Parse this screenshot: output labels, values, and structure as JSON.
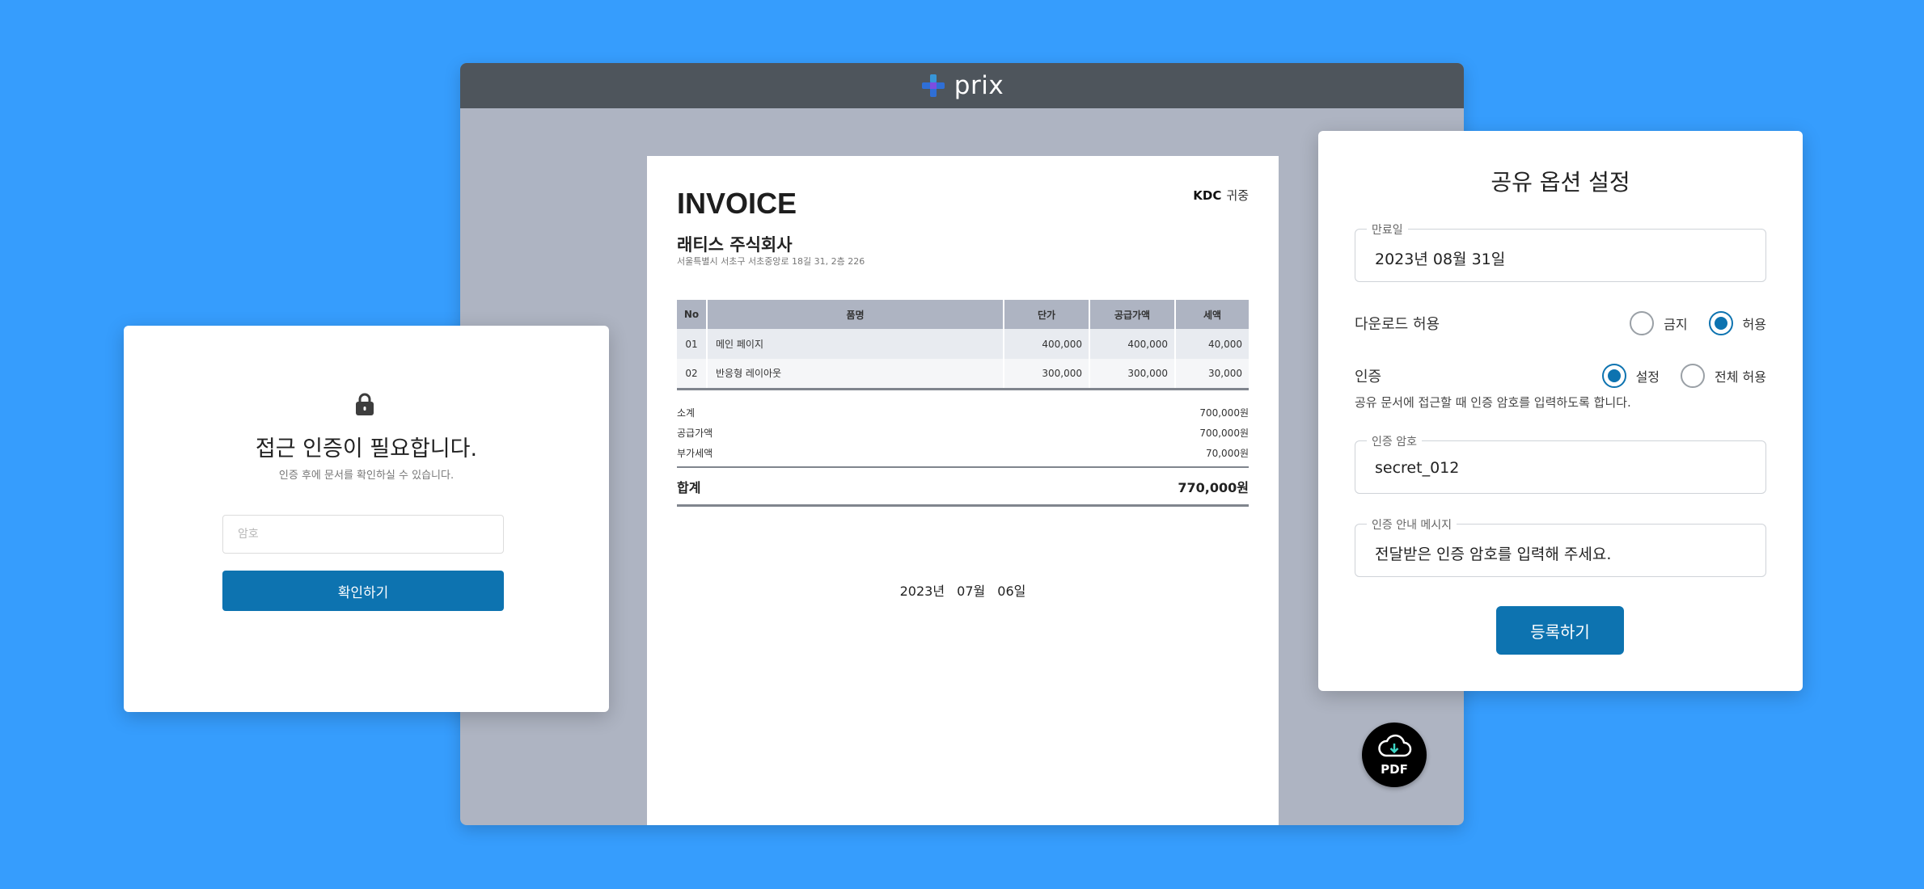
{
  "viewer": {
    "brand_name": "prix",
    "invoice": {
      "title": "INVOICE",
      "recipient_code": "KDC",
      "recipient_suffix": "귀중",
      "company_name": "래티스 주식회사",
      "company_address": "서울특별시 서초구 서초중앙로 18길 31, 2층 226",
      "columns": [
        "No",
        "품명",
        "단가",
        "공급가액",
        "세액"
      ],
      "rows": [
        {
          "no": "01",
          "item": "메인 페이지",
          "unit_price": "400,000",
          "supply": "400,000",
          "tax": "40,000"
        },
        {
          "no": "02",
          "item": "반응형 레이아웃",
          "unit_price": "300,000",
          "supply": "300,000",
          "tax": "30,000"
        }
      ],
      "summary": [
        {
          "label": "소계",
          "value": "700,000원"
        },
        {
          "label": "공급가액",
          "value": "700,000원"
        },
        {
          "label": "부가세액",
          "value": "70,000원"
        }
      ],
      "total_label": "합계",
      "total_value": "770,000원",
      "date": "2023년 07월 06일"
    },
    "pdf_label": "PDF"
  },
  "auth": {
    "title": "접근 인증이 필요합니다.",
    "subtitle": "인증 후에 문서를 확인하실 수 있습니다.",
    "password_placeholder": "암호",
    "confirm_label": "확인하기"
  },
  "share": {
    "title": "공유 옵션 설정",
    "expiry_label": "만료일",
    "expiry_value": "2023년 08월 31일",
    "download_label": "다운로드 허용",
    "download_options": [
      "금지",
      "허용"
    ],
    "download_selected": "허용",
    "auth_label": "인증",
    "auth_options": [
      "설정",
      "전체 허용"
    ],
    "auth_selected": "설정",
    "auth_description": "공유 문서에 접근할 때 인증 암호를 입력하도록 합니다.",
    "password_label": "인증 암호",
    "password_value": "secret_012",
    "message_label": "인증 안내 메시지",
    "message_value": "전달받은 인증 암호를 입력해 주세요.",
    "register_label": "등록하기"
  },
  "colors": {
    "background": "#369dfd",
    "primary": "#0d73b0",
    "viewer_bar": "#4e555c",
    "viewer_bg": "#aeb4c2"
  },
  "icons": [
    "prix-logo-icon",
    "lock-icon",
    "cloud-download-icon"
  ]
}
